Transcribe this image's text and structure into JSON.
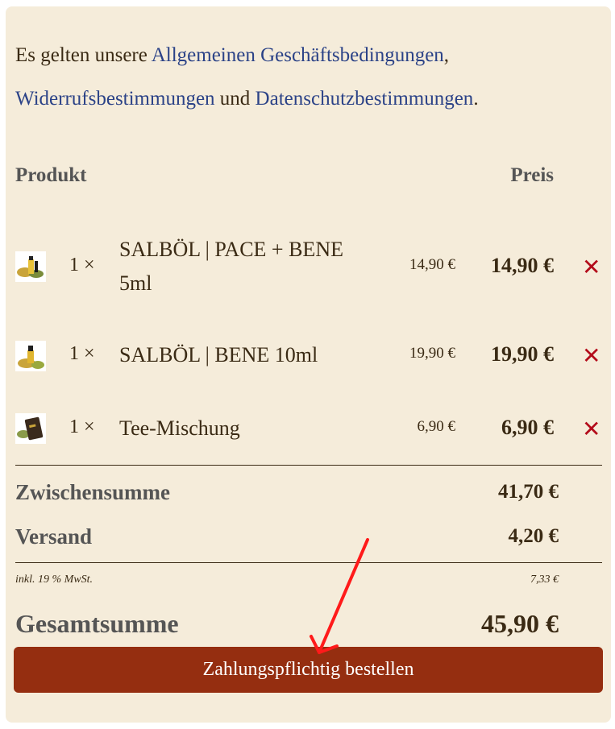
{
  "terms": {
    "prefix": "Es gelten unsere ",
    "link_agb": "Allgemeinen Geschäftsbedingungen",
    "sep1": ",",
    "link_widerruf": "Widerrufsbestimmungen",
    "middle": " und ",
    "link_datenschutz": "Datenschutzbestimmungen",
    "suffix": "."
  },
  "table": {
    "col_product": "Produkt",
    "col_price": "Preis"
  },
  "items": [
    {
      "qty": "1 ×",
      "name_line1": "SALBÖL | PACE + BENE",
      "name_line2": "5ml",
      "unit_price": "14,90 €",
      "total": "14,90 €",
      "icon": "oil-bottle-thumbnail"
    },
    {
      "qty": "1 ×",
      "name_line1": "SALBÖL | BENE 10ml",
      "unit_price": "19,90 €",
      "total": "19,90 €",
      "icon": "oil-bottle-thumbnail"
    },
    {
      "qty": "1 ×",
      "name_line1": "Tee-Mischung",
      "unit_price": "6,90 €",
      "total": "6,90 €",
      "icon": "tea-pack-thumbnail"
    }
  ],
  "remove_glyph": "✕",
  "totals": {
    "subtotal_label": "Zwischensumme",
    "subtotal_value": "41,70 €",
    "shipping_label": "Versand",
    "shipping_value": "4,20 €",
    "tax_label": "inkl. 19 % MwSt.",
    "tax_value": "7,33 €",
    "grand_label": "Gesamtsumme",
    "grand_value": "45,90 €"
  },
  "order_button": "Zahlungspflichtig bestellen",
  "colors": {
    "card_bg": "#f5ecda",
    "link": "#2b4287",
    "button": "#952e10",
    "remove": "#b30b1a",
    "annotation_arrow": "#ff1a1a"
  }
}
